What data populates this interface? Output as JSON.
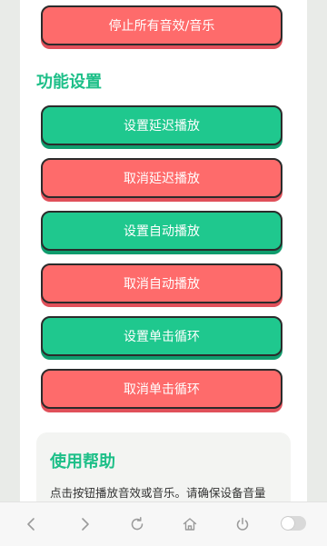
{
  "buttons": {
    "stop_all": "停止所有音效/音乐",
    "set_delay": "设置延迟播放",
    "cancel_delay": "取消延迟播放",
    "set_auto": "设置自动播放",
    "cancel_auto": "取消自动播放",
    "set_loop": "设置单击循环",
    "cancel_loop": "取消单击循环"
  },
  "sections": {
    "settings_title": "功能设置"
  },
  "help": {
    "title": "使用帮助",
    "text": "点击按钮播放音效或音乐。请确保设备音量"
  },
  "navbar": {
    "icons": [
      "back-icon",
      "forward-icon",
      "refresh-icon",
      "home-icon",
      "power-icon",
      "toggle-switch"
    ]
  },
  "colors": {
    "accent_green": "#1fc88e",
    "accent_red": "#fe6b6b",
    "title_green": "#1dbf88"
  }
}
